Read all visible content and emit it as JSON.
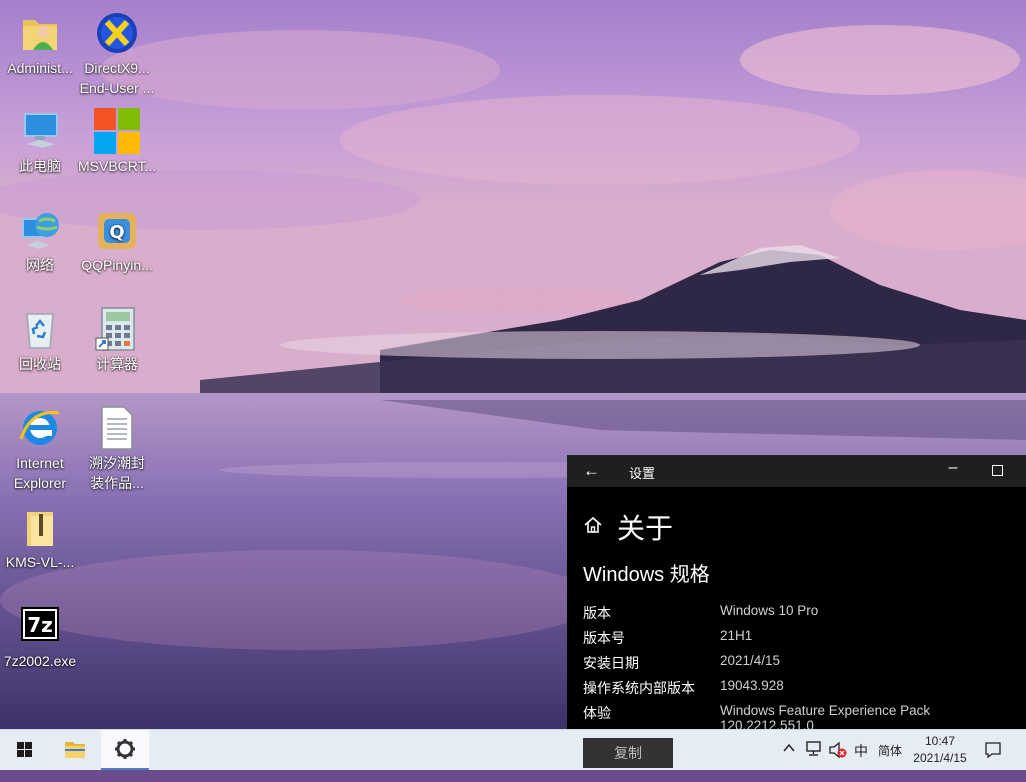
{
  "desktop": {
    "icons": [
      {
        "label": "Administ..."
      },
      {
        "label": "此电脑"
      },
      {
        "label": "网络"
      },
      {
        "label": "回收站"
      },
      {
        "label": "Internet\nExplorer"
      },
      {
        "label": "KMS-VL-..."
      },
      {
        "label": "7z2002.exe"
      },
      {
        "label": "DirectX9...\nEnd-User ..."
      },
      {
        "label": "MSVBCRT..."
      },
      {
        "label": "QQPinyin..."
      },
      {
        "label": "计算器"
      },
      {
        "label": "溯汐潮封\n装作品..."
      }
    ]
  },
  "settings": {
    "window_title": "设置",
    "page_title": "关于",
    "section_title": "Windows 规格",
    "specs": [
      {
        "key": "版本",
        "value": "Windows 10 Pro"
      },
      {
        "key": "版本号",
        "value": "21H1"
      },
      {
        "key": "安装日期",
        "value": "2021/4/15"
      },
      {
        "key": "操作系统内部版本",
        "value": "19043.928"
      },
      {
        "key": "体验",
        "value": "Windows Feature Experience Pack 120.2212.551.0"
      }
    ],
    "copy_label": "复制"
  },
  "taskbar": {
    "ime_lang": "中",
    "ime_mode": "简体",
    "time": "10:47",
    "date": "2021/4/15"
  },
  "icons": {
    "start": "windows-logo-icon",
    "explorer": "folder-icon",
    "settings": "gear-icon",
    "tray_up": "chevron-up-icon",
    "network": "network-icon",
    "volume": "volume-muted-icon",
    "notifications": "action-center-icon"
  }
}
